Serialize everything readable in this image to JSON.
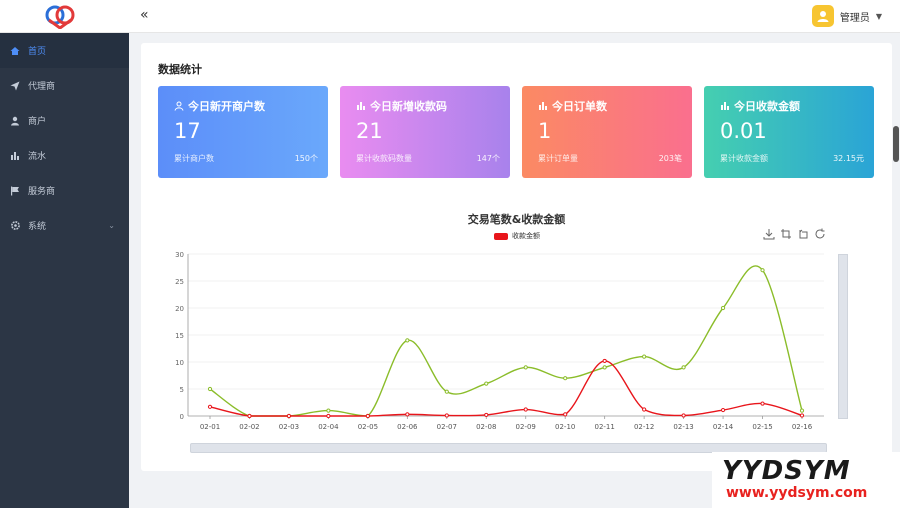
{
  "header": {
    "username": "管理员"
  },
  "sidebar": {
    "items": [
      {
        "label": "首页"
      },
      {
        "label": "代理商"
      },
      {
        "label": "商户"
      },
      {
        "label": "流水"
      },
      {
        "label": "服务商"
      },
      {
        "label": "系统"
      }
    ]
  },
  "main": {
    "section_title": "数据统计",
    "stats": [
      {
        "title": "今日新开商户数",
        "value": "17",
        "foot_label": "累计商户数",
        "foot_value": "150个"
      },
      {
        "title": "今日新增收款码",
        "value": "21",
        "foot_label": "累计收款码数量",
        "foot_value": "147个"
      },
      {
        "title": "今日订单数",
        "value": "1",
        "foot_label": "累计订单量",
        "foot_value": "203笔"
      },
      {
        "title": "今日收款金额",
        "value": "0.01",
        "foot_label": "累计收款金额",
        "foot_value": "32.15元"
      }
    ]
  },
  "chart_data": {
    "type": "line",
    "title": "交易笔数&收款金额",
    "categories": [
      "02-01",
      "02-02",
      "02-03",
      "02-04",
      "02-05",
      "02-06",
      "02-07",
      "02-08",
      "02-09",
      "02-10",
      "02-11",
      "02-12",
      "02-13",
      "02-14",
      "02-15",
      "02-16"
    ],
    "ylim": [
      0,
      30
    ],
    "yticks": [
      0,
      5,
      10,
      15,
      20,
      25,
      30
    ],
    "grid": true,
    "legend_position": "top-center",
    "series": [
      {
        "name": "收款金额",
        "color": "#e8151b",
        "values": [
          1.7,
          0,
          0,
          0,
          0,
          0.3,
          0.1,
          0.2,
          1.2,
          0.3,
          10.2,
          1.2,
          0.1,
          1.1,
          2.3,
          0.1
        ]
      },
      {
        "color": "#8bbd2a",
        "values": [
          5,
          0,
          0,
          1,
          0,
          14,
          4.5,
          6,
          9,
          7,
          9,
          11,
          9,
          20,
          27,
          1
        ]
      }
    ]
  },
  "watermark": {
    "big": "YYDSYM",
    "small": "www.yydsym.com"
  }
}
